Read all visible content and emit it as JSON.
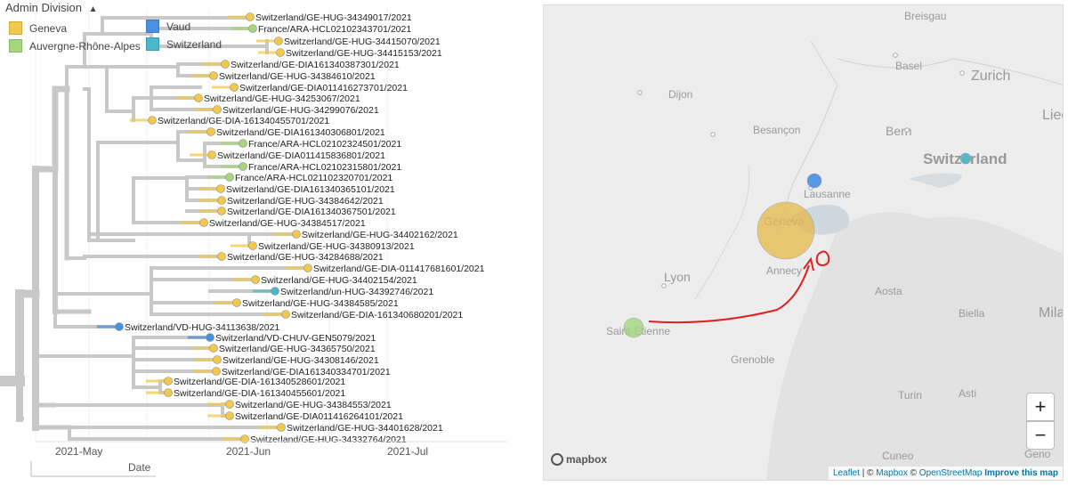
{
  "legend": {
    "title": "Admin Division",
    "items": [
      {
        "label": "Geneva",
        "color": "#f2c94c"
      },
      {
        "label": "Vaud",
        "color": "#4a90e2"
      },
      {
        "label": "Auvergne-Rhône-Alpes",
        "color": "#a5d67e"
      },
      {
        "label": "Switzerland",
        "color": "#4ab8c8"
      }
    ]
  },
  "axis": {
    "ticks": [
      "2021-May",
      "2021-Jun",
      "2021-Jul"
    ],
    "label": "Date"
  },
  "tips": [
    {
      "name": "Switzerland/GE-HUG-34349017/2021",
      "division": "Geneva"
    },
    {
      "name": "France/ARA-HCL02102343701/2021",
      "division": "Auvergne-Rhône-Alpes"
    },
    {
      "name": "Switzerland/GE-HUG-34415070/2021",
      "division": "Geneva"
    },
    {
      "name": "Switzerland/GE-HUG-34415153/2021",
      "division": "Geneva"
    },
    {
      "name": "Switzerland/GE-DIA161340387301/2021",
      "division": "Geneva"
    },
    {
      "name": "Switzerland/GE-HUG-34384610/2021",
      "division": "Geneva"
    },
    {
      "name": "Switzerland/GE-DIA011416273701/2021",
      "division": "Geneva"
    },
    {
      "name": "Switzerland/GE-HUG-34253067/2021",
      "division": "Geneva"
    },
    {
      "name": "Switzerland/GE-HUG-34299076/2021",
      "division": "Geneva"
    },
    {
      "name": "Switzerland/GE-DIA-161340455701/2021",
      "division": "Geneva"
    },
    {
      "name": "Switzerland/GE-DIA161340306801/2021",
      "division": "Geneva"
    },
    {
      "name": "France/ARA-HCL02102324501/2021",
      "division": "Auvergne-Rhône-Alpes"
    },
    {
      "name": "Switzerland/GE-DIA011415836801/2021",
      "division": "Geneva"
    },
    {
      "name": "France/ARA-HCL02102315801/2021",
      "division": "Auvergne-Rhône-Alpes"
    },
    {
      "name": "France/ARA-HCL021102320701/2021",
      "division": "Auvergne-Rhône-Alpes"
    },
    {
      "name": "Switzerland/GE-DIA161340365101/2021",
      "division": "Geneva"
    },
    {
      "name": "Switzerland/GE-HUG-34384642/2021",
      "division": "Geneva"
    },
    {
      "name": "Switzerland/GE-DIA161340367501/2021",
      "division": "Geneva"
    },
    {
      "name": "Switzerland/GE-HUG-34384517/2021",
      "division": "Geneva"
    },
    {
      "name": "Switzerland/GE-HUG-34402162/2021",
      "division": "Geneva"
    },
    {
      "name": "Switzerland/GE-HUG-34380913/2021",
      "division": "Geneva"
    },
    {
      "name": "Switzerland/GE-HUG-34284688/2021",
      "division": "Geneva"
    },
    {
      "name": "Switzerland/GE-DIA-011417681601/2021",
      "division": "Geneva"
    },
    {
      "name": "Switzerland/GE-HUG-34402154/2021",
      "division": "Geneva"
    },
    {
      "name": "Switzerland/un-HUG-34392746/2021",
      "division": "Switzerland"
    },
    {
      "name": "Switzerland/GE-HUG-34384585/2021",
      "division": "Geneva"
    },
    {
      "name": "Switzerland/GE-DIA-161340680201/2021",
      "division": "Geneva"
    },
    {
      "name": "Switzerland/VD-HUG-34113638/2021",
      "division": "Vaud"
    },
    {
      "name": "Switzerland/VD-CHUV-GEN5079/2021",
      "division": "Vaud"
    },
    {
      "name": "Switzerland/GE-HUG-34365750/2021",
      "division": "Geneva"
    },
    {
      "name": "Switzerland/GE-HUG-34308146/2021",
      "division": "Geneva"
    },
    {
      "name": "Switzerland/GE-DIA161340334701/2021",
      "division": "Geneva"
    },
    {
      "name": "Switzerland/GE-DIA-161340528601/2021",
      "division": "Geneva"
    },
    {
      "name": "Switzerland/GE-DIA-161340455601/2021",
      "division": "Geneva"
    },
    {
      "name": "Switzerland/GE-HUG-34384553/2021",
      "division": "Geneva"
    },
    {
      "name": "Switzerland/GE-DIA011416264101/2021",
      "division": "Geneva"
    },
    {
      "name": "Switzerland/GE-HUG-34401628/2021",
      "division": "Geneva"
    },
    {
      "name": "Switzerland/GE-HUG-34332764/2021",
      "division": "Geneva"
    }
  ],
  "map": {
    "places": [
      {
        "name": "Breisgau",
        "kind": "city"
      },
      {
        "name": "Basel",
        "kind": "city"
      },
      {
        "name": "Zurich",
        "kind": "city"
      },
      {
        "name": "Liec",
        "kind": "city"
      },
      {
        "name": "Dijon",
        "kind": "city"
      },
      {
        "name": "Besançon",
        "kind": "city"
      },
      {
        "name": "Bern",
        "kind": "city"
      },
      {
        "name": "Switzerland",
        "kind": "country"
      },
      {
        "name": "Lausanne",
        "kind": "city"
      },
      {
        "name": "Geneva",
        "kind": "city"
      },
      {
        "name": "Annecy",
        "kind": "city"
      },
      {
        "name": "Lyon",
        "kind": "city"
      },
      {
        "name": "Aosta",
        "kind": "city"
      },
      {
        "name": "Biella",
        "kind": "city"
      },
      {
        "name": "Mila",
        "kind": "city"
      },
      {
        "name": "Saint-Étienne",
        "kind": "city"
      },
      {
        "name": "Grenoble",
        "kind": "city"
      },
      {
        "name": "Turin",
        "kind": "city"
      },
      {
        "name": "Asti",
        "kind": "city"
      },
      {
        "name": "Cuneo",
        "kind": "city"
      },
      {
        "name": "Geno",
        "kind": "city"
      }
    ],
    "bubbles": [
      {
        "place": "Geneva",
        "color": "#e6b94a"
      },
      {
        "place": "Lausanne",
        "color": "#4a90e2"
      },
      {
        "place": "Saint-Étienne",
        "color": "#a5d67e"
      },
      {
        "place": "Switzerland",
        "color": "#4ab8c8"
      }
    ],
    "zoom_in": "+",
    "zoom_out": "−",
    "logo": "mapbox",
    "attribution": {
      "leaflet": "Leaflet",
      "sep1": " | © ",
      "mapbox": "Mapbox",
      "sep2": " © ",
      "osm": "OpenStreetMap",
      "improve": "Improve this map"
    }
  }
}
